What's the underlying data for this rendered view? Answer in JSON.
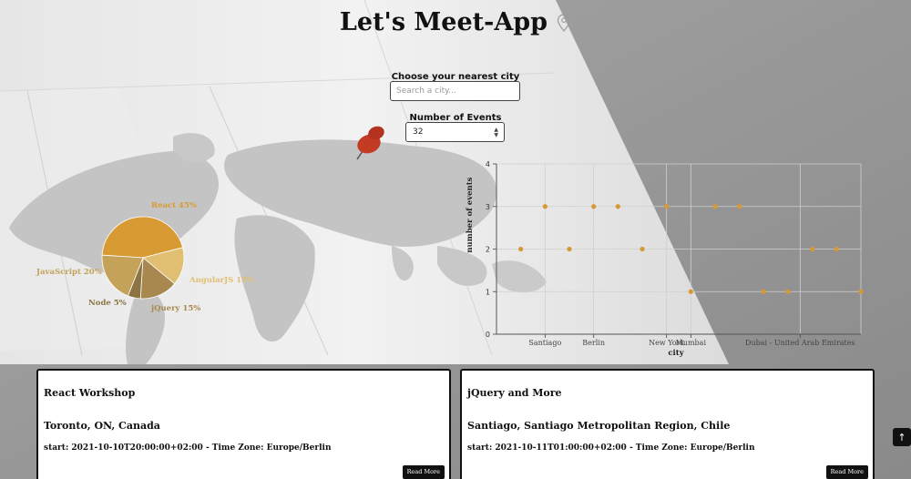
{
  "app": {
    "title": "Let's Meet-App"
  },
  "search": {
    "label": "Choose your nearest city",
    "placeholder": "Search a city..."
  },
  "events_count": {
    "label": "Number of Events",
    "value": "32"
  },
  "colors": {
    "accent": "#d59a34",
    "pie": [
      "#d89b33",
      "#e0bf73",
      "#a8884f",
      "#8c7443",
      "#c4a259"
    ],
    "card_border": "#111111"
  },
  "pie_chart": {
    "chart_data": {
      "type": "pie",
      "slices": [
        {
          "label": "React",
          "value": 45,
          "display": "React 45%"
        },
        {
          "label": "AngularJS",
          "value": 15,
          "display": "AngularJS 15%"
        },
        {
          "label": "jQuery",
          "value": 15,
          "display": "jQuery 15%"
        },
        {
          "label": "Node",
          "value": 5,
          "display": "Node 5%"
        },
        {
          "label": "JavaScript",
          "value": 20,
          "display": "JavaScript 20%"
        }
      ]
    }
  },
  "chart_data": {
    "type": "scatter",
    "xlabel": "city",
    "ylabel": "number of events",
    "ylim": [
      0,
      4
    ],
    "yticks": [
      "0",
      "1",
      "2",
      "3",
      "4"
    ],
    "x_tick_labels": [
      "Santiago",
      "Berlin",
      "New York",
      "Mumbai",
      "Dubai - United Arab Emirates"
    ],
    "grid": true,
    "points": [
      {
        "x": 1,
        "y": 2
      },
      {
        "x": 2,
        "y": 3
      },
      {
        "x": 3,
        "y": 2
      },
      {
        "x": 4,
        "y": 3
      },
      {
        "x": 5,
        "y": 3
      },
      {
        "x": 6,
        "y": 2
      },
      {
        "x": 7,
        "y": 3
      },
      {
        "x": 8,
        "y": 1
      },
      {
        "x": 9,
        "y": 3
      },
      {
        "x": 10,
        "y": 3
      },
      {
        "x": 11,
        "y": 1
      },
      {
        "x": 12,
        "y": 1
      },
      {
        "x": 13,
        "y": 2
      },
      {
        "x": 14,
        "y": 2
      },
      {
        "x": 15,
        "y": 1
      }
    ],
    "tick_positions": [
      2,
      4,
      7,
      8,
      12.5
    ]
  },
  "events": [
    {
      "summary": "React Workshop",
      "location": "Toronto, ON, Canada",
      "start": "start: 2021-10-10T20:00:00+02:00 - Time Zone: Europe/Berlin",
      "button": "Read More"
    },
    {
      "summary": "jQuery and More",
      "location": "Santiago, Santiago Metropolitan Region, Chile",
      "start": "start: 2021-10-11T01:00:00+02:00 - Time Zone: Europe/Berlin",
      "button": "Read More"
    }
  ],
  "scroll_top": {
    "icon": "arrow-up-icon",
    "glyph": "↑"
  }
}
